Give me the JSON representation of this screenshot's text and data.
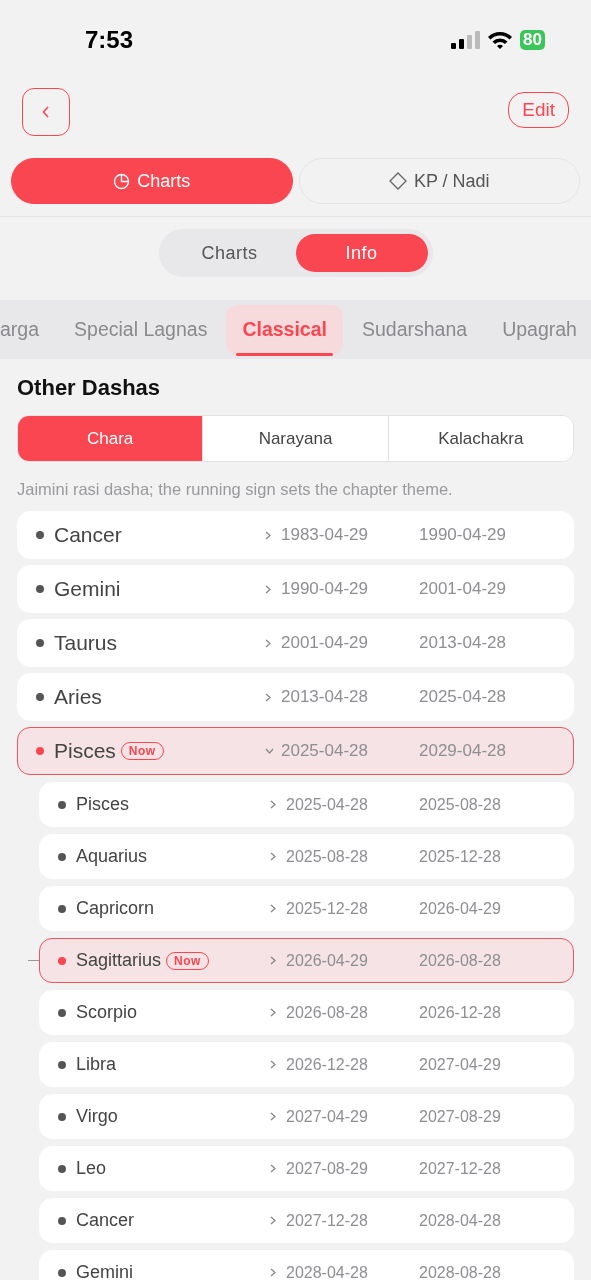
{
  "status_bar": {
    "time": "7:53",
    "battery": "80"
  },
  "header": {
    "edit_button": "Edit"
  },
  "mode_tabs": [
    {
      "label": "Charts",
      "selected": true
    },
    {
      "label": "KP / Nadi",
      "selected": false
    }
  ],
  "view_toggle": [
    {
      "label": "Charts",
      "selected": false
    },
    {
      "label": "Info",
      "selected": true
    }
  ],
  "category_tabs": [
    {
      "label": "arga",
      "selected": false
    },
    {
      "label": "Special Lagnas",
      "selected": false
    },
    {
      "label": "Classical",
      "selected": true
    },
    {
      "label": "Sudarshana",
      "selected": false
    },
    {
      "label": "Upagrah",
      "selected": false
    }
  ],
  "section_title": "Other Dashas",
  "dasha_tabs": [
    {
      "label": "Chara",
      "selected": true
    },
    {
      "label": "Narayana",
      "selected": false
    },
    {
      "label": "Kalachakra",
      "selected": false
    }
  ],
  "description": "Jaimini rasi dasha; the running sign sets the chapter theme.",
  "dashas": [
    {
      "sign": "Cancer",
      "start": "1983-04-29",
      "end": "1990-04-29",
      "current": false,
      "expanded": false
    },
    {
      "sign": "Gemini",
      "start": "1990-04-29",
      "end": "2001-04-29",
      "current": false,
      "expanded": false
    },
    {
      "sign": "Taurus",
      "start": "2001-04-29",
      "end": "2013-04-28",
      "current": false,
      "expanded": false
    },
    {
      "sign": "Aries",
      "start": "2013-04-28",
      "end": "2025-04-28",
      "current": false,
      "expanded": false
    },
    {
      "sign": "Pisces",
      "badge": "Now",
      "start": "2025-04-28",
      "end": "2029-04-28",
      "current": true,
      "expanded": true,
      "children": [
        {
          "sign": "Pisces",
          "start": "2025-04-28",
          "end": "2025-08-28",
          "current": false,
          "expanded": false
        },
        {
          "sign": "Aquarius",
          "start": "2025-08-28",
          "end": "2025-12-28",
          "current": false,
          "expanded": false
        },
        {
          "sign": "Capricorn",
          "start": "2025-12-28",
          "end": "2026-04-29",
          "current": false,
          "expanded": false
        },
        {
          "sign": "Sagittarius",
          "badge": "Now",
          "start": "2026-04-29",
          "end": "2026-08-28",
          "current": true,
          "expanded": false
        },
        {
          "sign": "Scorpio",
          "start": "2026-08-28",
          "end": "2026-12-28",
          "current": false,
          "expanded": false
        },
        {
          "sign": "Libra",
          "start": "2026-12-28",
          "end": "2027-04-29",
          "current": false,
          "expanded": false
        },
        {
          "sign": "Virgo",
          "start": "2027-04-29",
          "end": "2027-08-29",
          "current": false,
          "expanded": false
        },
        {
          "sign": "Leo",
          "start": "2027-08-29",
          "end": "2027-12-28",
          "current": false,
          "expanded": false
        },
        {
          "sign": "Cancer",
          "start": "2027-12-28",
          "end": "2028-04-28",
          "current": false,
          "expanded": false
        },
        {
          "sign": "Gemini",
          "start": "2028-04-28",
          "end": "2028-08-28",
          "current": false,
          "expanded": false
        }
      ]
    }
  ]
}
